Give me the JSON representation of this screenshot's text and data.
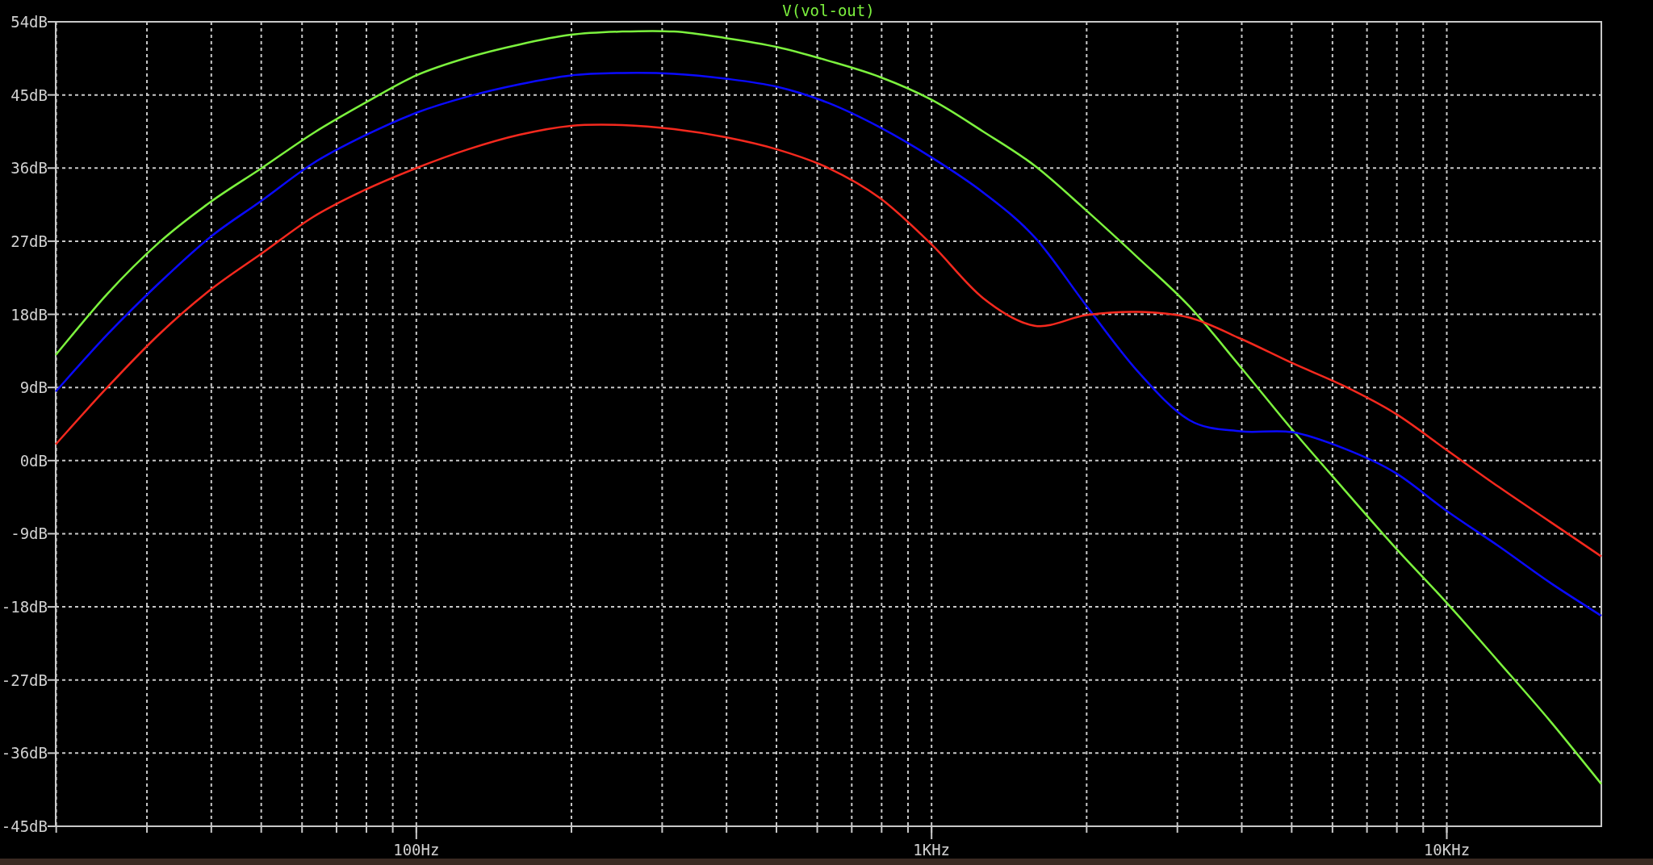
{
  "plot": {
    "chart_data": {
      "type": "line",
      "title": "V(vol-out)",
      "categories": [
        null,
        null,
        null,
        null,
        null,
        null,
        null,
        "100Hz",
        null,
        null,
        null,
        null,
        null,
        null,
        null,
        null,
        null,
        "1KHz",
        null,
        null,
        null,
        null,
        null,
        null,
        null,
        null,
        null,
        "10KHz",
        null,
        null,
        null
      ],
      "series": [
        {
          "color": "#7cf23e",
          "values": [
            13.0,
            20.5,
            26.8,
            31.8,
            36.0,
            40.3,
            44.0,
            47.4,
            49.6,
            51.2,
            52.4,
            52.8,
            52.8,
            52.0,
            50.9,
            49.2,
            47.2,
            44.4,
            40.5,
            36.3,
            30.8,
            25.0,
            19.0,
            11.5,
            3.8,
            -3.5,
            -10.7,
            -17.5,
            -24.7,
            -32.0,
            -39.8
          ]
        },
        {
          "color": "#0a0aff",
          "values": [
            8.5,
            15.5,
            21.8,
            27.5,
            32.0,
            36.6,
            40.0,
            42.8,
            44.8,
            46.3,
            47.4,
            47.7,
            47.6,
            47.0,
            46.0,
            44.0,
            41.0,
            37.3,
            33.0,
            27.5,
            19.1,
            11.0,
            5.0,
            3.6,
            3.5,
            1.5,
            -1.5,
            -6.2,
            -10.5,
            -15.0,
            -19.1
          ]
        },
        {
          "color": "#f5291e",
          "values": [
            2.0,
            9.0,
            15.5,
            21.0,
            25.5,
            30.0,
            33.3,
            36.0,
            38.3,
            40.1,
            41.2,
            41.3,
            40.8,
            39.8,
            38.3,
            36.0,
            32.3,
            26.6,
            20.0,
            16.6,
            17.9,
            18.3,
            17.6,
            15.0,
            12.0,
            9.2,
            5.8,
            1.3,
            -3.2,
            -7.5,
            -11.8
          ]
        }
      ],
      "ylim": [
        -45,
        54
      ],
      "grid": true,
      "yticks": [
        {
          "value": 54,
          "label": "54dB"
        },
        {
          "value": 45,
          "label": "45dB"
        },
        {
          "value": 36,
          "label": "36dB"
        },
        {
          "value": 27,
          "label": "27dB"
        },
        {
          "value": 18,
          "label": "18dB"
        },
        {
          "value": 9,
          "label": "9dB"
        },
        {
          "value": 0,
          "label": "0dB"
        },
        {
          "value": -9,
          "label": "-9dB"
        },
        {
          "value": -18,
          "label": "-18dB"
        },
        {
          "value": -27,
          "label": "-27dB"
        },
        {
          "value": -36,
          "label": "-36dB"
        },
        {
          "value": -45,
          "label": "-45dB"
        }
      ]
    }
  }
}
